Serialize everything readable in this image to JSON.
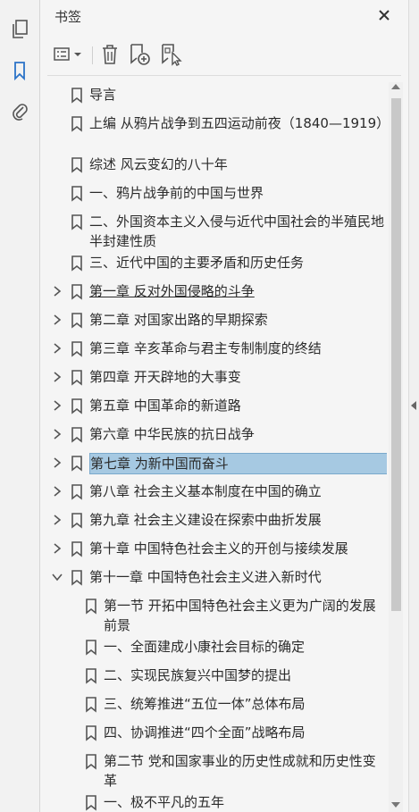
{
  "rail": {
    "items": [
      {
        "icon": "pages-icon"
      },
      {
        "icon": "bookmark-icon",
        "active": true
      },
      {
        "icon": "attachment-icon"
      }
    ]
  },
  "panel": {
    "title": "书签",
    "toolbar": [
      "options-menu-icon",
      "delete-icon",
      "new-bookmark-icon",
      "bookmark-from-selection-icon"
    ]
  },
  "bookmarks": [
    {
      "label": "导言",
      "level": 0,
      "expander": "none"
    },
    {
      "label": "上编  从鸦片战争到五四运动前夜（1840—1919）",
      "level": 0,
      "expander": "none",
      "lines": 2
    },
    {
      "label": "综述  风云变幻的八十年",
      "level": 0,
      "expander": "none"
    },
    {
      "label": "一、鸦片战争前的中国与世界",
      "level": 0,
      "expander": "none"
    },
    {
      "label": "二、外国资本主义入侵与近代中国社会的半殖民地半封建性质",
      "level": 0,
      "expander": "none",
      "lines": 2
    },
    {
      "label": "三、近代中国的主要矛盾和历史任务",
      "level": 0,
      "expander": "none"
    },
    {
      "label": "第一章  反对外国侵略的斗争",
      "level": 0,
      "expander": "collapsed",
      "underline": true
    },
    {
      "label": "第二章  对国家出路的早期探索",
      "level": 0,
      "expander": "collapsed"
    },
    {
      "label": "第三章  辛亥革命与君主专制制度的终结",
      "level": 0,
      "expander": "collapsed"
    },
    {
      "label": "第四章  开天辟地的大事变",
      "level": 0,
      "expander": "collapsed"
    },
    {
      "label": "第五章  中国革命的新道路",
      "level": 0,
      "expander": "collapsed"
    },
    {
      "label": "第六章  中华民族的抗日战争",
      "level": 0,
      "expander": "collapsed"
    },
    {
      "label": "第七章  为新中国而奋斗",
      "level": 0,
      "expander": "collapsed",
      "selected": true
    },
    {
      "label": "第八章  社会主义基本制度在中国的确立",
      "level": 0,
      "expander": "collapsed"
    },
    {
      "label": "第九章  社会主义建设在探索中曲折发展",
      "level": 0,
      "expander": "collapsed"
    },
    {
      "label": "第十章  中国特色社会主义的开创与接续发展",
      "level": 0,
      "expander": "collapsed"
    },
    {
      "label": "第十一章  中国特色社会主义进入新时代",
      "level": 0,
      "expander": "expanded"
    },
    {
      "label": "第一节  开拓中国特色社会主义更为广阔的发展前景",
      "level": 1,
      "expander": "none",
      "lines": 2
    },
    {
      "label": "一、全面建成小康社会目标的确定",
      "level": 1,
      "expander": "none"
    },
    {
      "label": "二、实现民族复兴中国梦的提出",
      "level": 1,
      "expander": "none"
    },
    {
      "label": "三、统筹推进“五位一体”总体布局",
      "level": 1,
      "expander": "none"
    },
    {
      "label": "四、协调推进“四个全面”战略布局",
      "level": 1,
      "expander": "none"
    },
    {
      "label": "第二节  党和国家事业的历史性成就和历史性变革",
      "level": 1,
      "expander": "none",
      "lines": 2
    },
    {
      "label": "一、极不平凡的五年",
      "level": 1,
      "expander": "none"
    }
  ],
  "colors": {
    "selection": "#a6c9e2",
    "icon": "#555555",
    "accent": "#2b73c8"
  }
}
